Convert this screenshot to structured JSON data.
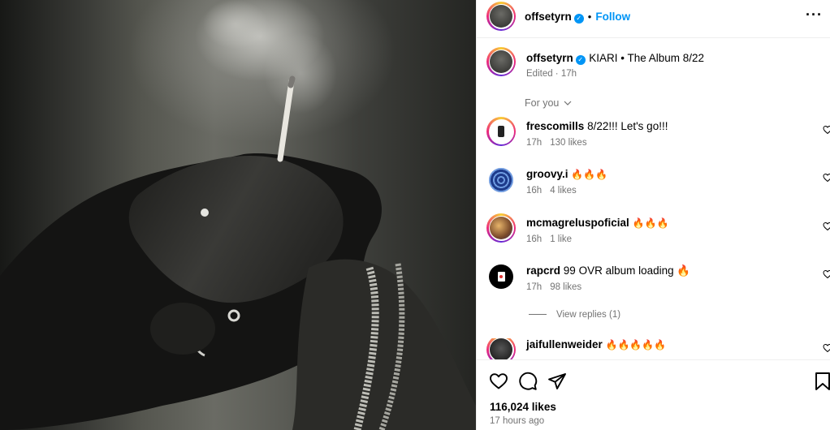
{
  "post": {
    "author": "offsetyrn",
    "follow_label": "Follow",
    "dot": "•",
    "more_icon": "more-horizontal-icon"
  },
  "caption": {
    "username": "offsetyrn",
    "text": "KIARI • The Album 8/22",
    "edited": "Edited",
    "time": "17h"
  },
  "for_you": "For you",
  "comments": [
    {
      "username": "frescomills",
      "text": "8/22!!! Let's go!!!",
      "time": "17h",
      "likes": "130 likes"
    },
    {
      "username": "groovy.i",
      "text": "🔥🔥🔥",
      "time": "16h",
      "likes": "4 likes"
    },
    {
      "username": "mcmagreluspoficial",
      "text": "🔥🔥🔥",
      "time": "16h",
      "likes": "1 like"
    },
    {
      "username": "rapcrd",
      "text": "99 OVR album loading 🔥",
      "time": "17h",
      "likes": "98 likes"
    },
    {
      "username": "jaifullenweider",
      "text": "🔥🔥🔥🔥🔥",
      "time": "",
      "likes": ""
    }
  ],
  "view_replies": "View replies (1)",
  "footer": {
    "likes": "116,024 likes",
    "time": "17 hours ago"
  },
  "colors": {
    "accent": "#0095f6",
    "muted": "#737373",
    "border": "#efefef"
  }
}
